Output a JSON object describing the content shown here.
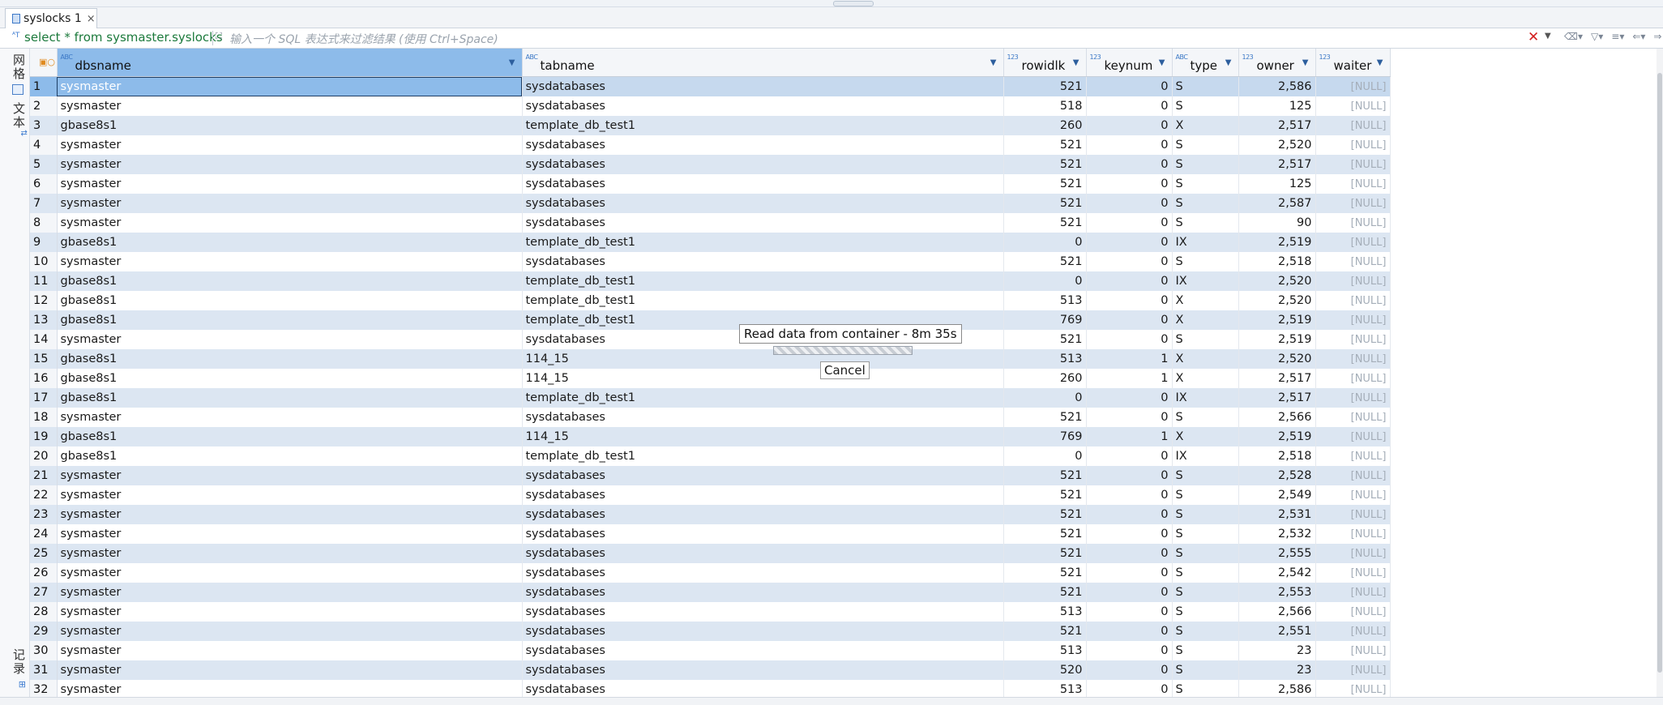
{
  "tab": {
    "title": "syslocks 1",
    "close": "×"
  },
  "filter": {
    "sql": "select * from sysmaster.syslocks",
    "placeholder": "输入一个 SQL 表达式来过滤结果 (使用 Ctrl+Space)",
    "clear": "✕"
  },
  "sidebar": {
    "grid_label": "网格",
    "text_label": "文本",
    "record_label": "记录"
  },
  "columns": [
    {
      "name": "dbsname",
      "type_tag": "ABC"
    },
    {
      "name": "tabname",
      "type_tag": "ABC"
    },
    {
      "name": "rowidlk",
      "type_tag": "123"
    },
    {
      "name": "keynum",
      "type_tag": "123"
    },
    {
      "name": "type",
      "type_tag": "ABC"
    },
    {
      "name": "owner",
      "type_tag": "123"
    },
    {
      "name": "waiter",
      "type_tag": "123"
    }
  ],
  "rows": [
    [
      "1",
      "sysmaster",
      "sysdatabases",
      "521",
      "0",
      "S",
      "2,586",
      "[NULL]"
    ],
    [
      "2",
      "sysmaster",
      "sysdatabases",
      "518",
      "0",
      "S",
      "125",
      "[NULL]"
    ],
    [
      "3",
      "gbase8s1",
      "template_db_test1",
      "260",
      "0",
      "X",
      "2,517",
      "[NULL]"
    ],
    [
      "4",
      "sysmaster",
      "sysdatabases",
      "521",
      "0",
      "S",
      "2,520",
      "[NULL]"
    ],
    [
      "5",
      "sysmaster",
      "sysdatabases",
      "521",
      "0",
      "S",
      "2,517",
      "[NULL]"
    ],
    [
      "6",
      "sysmaster",
      "sysdatabases",
      "521",
      "0",
      "S",
      "125",
      "[NULL]"
    ],
    [
      "7",
      "sysmaster",
      "sysdatabases",
      "521",
      "0",
      "S",
      "2,587",
      "[NULL]"
    ],
    [
      "8",
      "sysmaster",
      "sysdatabases",
      "521",
      "0",
      "S",
      "90",
      "[NULL]"
    ],
    [
      "9",
      "gbase8s1",
      "template_db_test1",
      "0",
      "0",
      "IX",
      "2,519",
      "[NULL]"
    ],
    [
      "10",
      "sysmaster",
      "sysdatabases",
      "521",
      "0",
      "S",
      "2,518",
      "[NULL]"
    ],
    [
      "11",
      "gbase8s1",
      "template_db_test1",
      "0",
      "0",
      "IX",
      "2,520",
      "[NULL]"
    ],
    [
      "12",
      "gbase8s1",
      "template_db_test1",
      "513",
      "0",
      "X",
      "2,520",
      "[NULL]"
    ],
    [
      "13",
      "gbase8s1",
      "template_db_test1",
      "769",
      "0",
      "X",
      "2,519",
      "[NULL]"
    ],
    [
      "14",
      "sysmaster",
      "sysdatabases",
      "521",
      "0",
      "S",
      "2,519",
      "[NULL]"
    ],
    [
      "15",
      "gbase8s1",
      " 114_15",
      "513",
      "1",
      "X",
      "2,520",
      "[NULL]"
    ],
    [
      "16",
      "gbase8s1",
      " 114_15",
      "260",
      "1",
      "X",
      "2,517",
      "[NULL]"
    ],
    [
      "17",
      "gbase8s1",
      "template_db_test1",
      "0",
      "0",
      "IX",
      "2,517",
      "[NULL]"
    ],
    [
      "18",
      "sysmaster",
      "sysdatabases",
      "521",
      "0",
      "S",
      "2,566",
      "[NULL]"
    ],
    [
      "19",
      "gbase8s1",
      " 114_15",
      "769",
      "1",
      "X",
      "2,519",
      "[NULL]"
    ],
    [
      "20",
      "gbase8s1",
      "template_db_test1",
      "0",
      "0",
      "IX",
      "2,518",
      "[NULL]"
    ],
    [
      "21",
      "sysmaster",
      "sysdatabases",
      "521",
      "0",
      "S",
      "2,528",
      "[NULL]"
    ],
    [
      "22",
      "sysmaster",
      "sysdatabases",
      "521",
      "0",
      "S",
      "2,549",
      "[NULL]"
    ],
    [
      "23",
      "sysmaster",
      "sysdatabases",
      "521",
      "0",
      "S",
      "2,531",
      "[NULL]"
    ],
    [
      "24",
      "sysmaster",
      "sysdatabases",
      "521",
      "0",
      "S",
      "2,532",
      "[NULL]"
    ],
    [
      "25",
      "sysmaster",
      "sysdatabases",
      "521",
      "0",
      "S",
      "2,555",
      "[NULL]"
    ],
    [
      "26",
      "sysmaster",
      "sysdatabases",
      "521",
      "0",
      "S",
      "2,542",
      "[NULL]"
    ],
    [
      "27",
      "sysmaster",
      "sysdatabases",
      "521",
      "0",
      "S",
      "2,553",
      "[NULL]"
    ],
    [
      "28",
      "sysmaster",
      "sysdatabases",
      "513",
      "0",
      "S",
      "2,566",
      "[NULL]"
    ],
    [
      "29",
      "sysmaster",
      "sysdatabases",
      "521",
      "0",
      "S",
      "2,551",
      "[NULL]"
    ],
    [
      "30",
      "sysmaster",
      "sysdatabases",
      "513",
      "0",
      "S",
      "23",
      "[NULL]"
    ],
    [
      "31",
      "sysmaster",
      "sysdatabases",
      "520",
      "0",
      "S",
      "23",
      "[NULL]"
    ],
    [
      "32",
      "sysmaster",
      "sysdatabases",
      "513",
      "0",
      "S",
      "2,586",
      "[NULL]"
    ]
  ],
  "progress": {
    "label": "Read data from container - 8m 35s",
    "cancel": "Cancel"
  },
  "icons": {
    "tab": "table-icon",
    "sort": "chevron-down-icon",
    "clear": "close-icon"
  },
  "colors": {
    "selected_header": "#8dbbea",
    "alt_row": "#dce6f2",
    "sql_text": "#1c7a3c"
  }
}
